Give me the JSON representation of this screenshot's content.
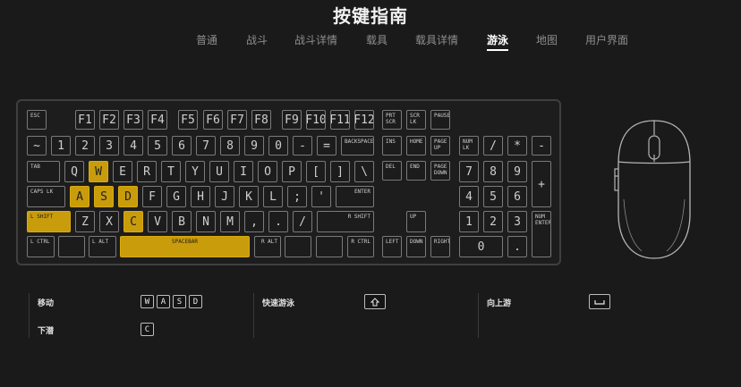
{
  "header": {
    "title": "按键指南"
  },
  "tabs": [
    {
      "label": "普通",
      "active": false
    },
    {
      "label": "战斗",
      "active": false
    },
    {
      "label": "战斗详情",
      "active": false
    },
    {
      "label": "载具",
      "active": false
    },
    {
      "label": "载具详情",
      "active": false
    },
    {
      "label": "游泳",
      "active": true
    },
    {
      "label": "地图",
      "active": false
    },
    {
      "label": "用户界面",
      "active": false
    }
  ],
  "colors": {
    "highlight": "#c99c0b",
    "background": "#1a1a1a",
    "key_border": "#7a7a7a"
  },
  "keys": {
    "esc": "ESC",
    "f1": "F1",
    "f2": "F2",
    "f3": "F3",
    "f4": "F4",
    "f5": "F5",
    "f6": "F6",
    "f7": "F7",
    "f8": "F8",
    "f9": "F9",
    "f10": "F10",
    "f11": "F11",
    "f12": "F12",
    "prtscr": "PRT SCR",
    "scrlk": "SCR LK",
    "pause": "PAUSE",
    "tilde": "~",
    "n1": "1",
    "n2": "2",
    "n3": "3",
    "n4": "4",
    "n5": "5",
    "n6": "6",
    "n7": "7",
    "n8": "8",
    "n9": "9",
    "n0": "0",
    "minus": "-",
    "equal": "=",
    "backspace": "BACKSPACE",
    "ins": "INS",
    "home": "HOME",
    "pgup": "PAGE UP",
    "numlk": "NUM LK",
    "npdiv": "/",
    "npmul": "*",
    "npsub": "-",
    "tab": "TAB",
    "q": "Q",
    "w": "W",
    "e": "E",
    "r": "R",
    "t": "T",
    "y": "Y",
    "u": "U",
    "i": "I",
    "o": "O",
    "p": "P",
    "lbr": "[",
    "rbr": "]",
    "bslash": "\\",
    "del": "DEL",
    "end": "END",
    "pgdn": "PAGE DOWN",
    "np7": "7",
    "np8": "8",
    "np9": "9",
    "npadd": "+",
    "caps": "CAPS LK",
    "a": "A",
    "s": "S",
    "d": "D",
    "f": "F",
    "g": "G",
    "h": "H",
    "j": "J",
    "k": "K",
    "l": "L",
    "semi": ";",
    "quote": "'",
    "enter": "ENTER",
    "np4": "4",
    "np5": "5",
    "np6": "6",
    "lshift": "L SHIFT",
    "z": "Z",
    "x": "X",
    "c": "C",
    "v": "V",
    "b": "B",
    "n": "N",
    "m": "M",
    "comma": ",",
    "period": ".",
    "slash": "/",
    "rshift": "R SHIFT",
    "up": "UP",
    "np1": "1",
    "np2": "2",
    "np3": "3",
    "npenter": "NUM ENTER",
    "lctrl": "L CTRL",
    "win": "",
    "lalt": "L ALT",
    "space": "SPACEBAR",
    "ralt": "R ALT",
    "fn": "",
    "menu": "",
    "rctrl": "R CTRL",
    "left": "LEFT",
    "down": "DOWN",
    "right": "RIGHT",
    "np0": "0",
    "npdot": "."
  },
  "highlighted_keys": [
    "w",
    "a",
    "s",
    "d",
    "lshift",
    "c",
    "space"
  ],
  "legend": {
    "move": {
      "label": "移动",
      "keys": [
        "W",
        "A",
        "S",
        "D"
      ]
    },
    "dive": {
      "label": "下潜",
      "keys": [
        "C"
      ]
    },
    "fast_swim": {
      "label": "快速游泳",
      "icon": "lshift-icon"
    },
    "swim_up": {
      "label": "向上游",
      "icon": "spacebar-icon"
    }
  }
}
